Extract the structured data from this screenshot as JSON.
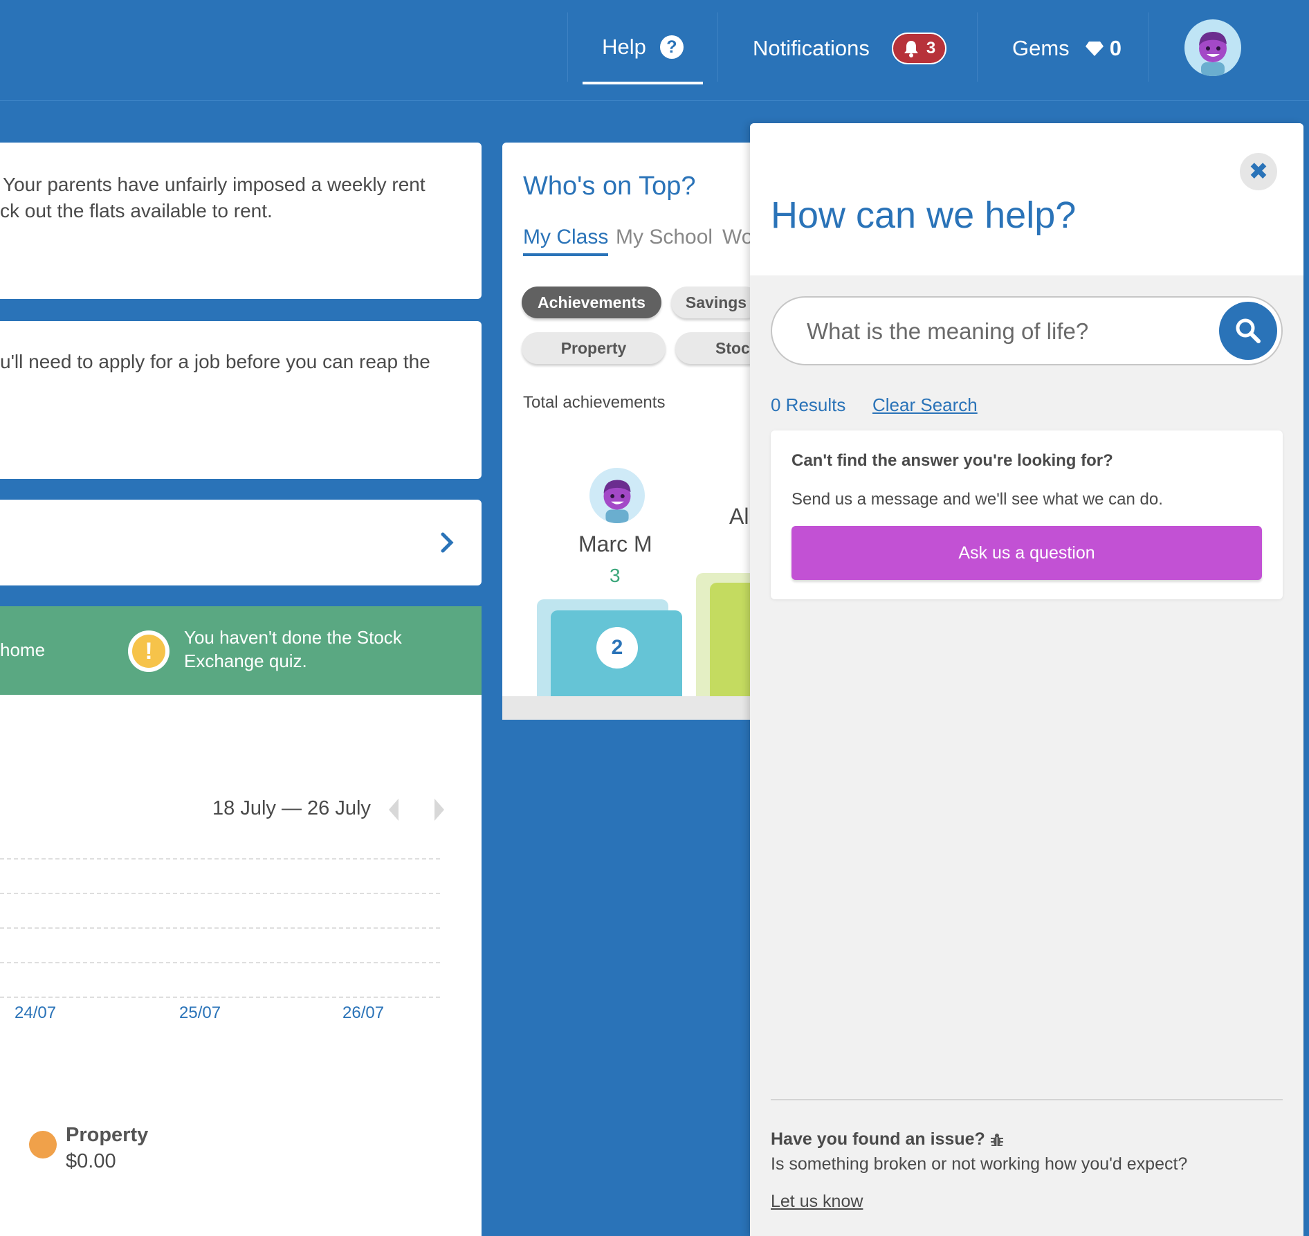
{
  "topbar": {
    "help_label": "Help",
    "help_icon": "?",
    "notifications_label": "Notifications",
    "notifications_count": "3",
    "gems_label": "Gems",
    "gems_count": "0"
  },
  "left_cards": {
    "card1_line1": "Your parents have unfairly imposed a weekly rent",
    "card1_line2": "ck out the flats available to rent.",
    "card2_line1": "u'll need to apply for a job before you can reap the"
  },
  "banner": {
    "left_text": "home",
    "warning_icon": "!",
    "warning_line1": "You haven't done the Stock",
    "warning_line2": "Exchange quiz."
  },
  "chart": {
    "date_range": "18 July — 26 July",
    "ticks": [
      "24/07",
      "25/07",
      "26/07"
    ],
    "legend": {
      "name": "Property",
      "value": "$0.00",
      "color": "#f0a14a"
    }
  },
  "who": {
    "title": "Who's on Top?",
    "tabs": [
      "My Class",
      "My School",
      "Wo"
    ],
    "pills": [
      "Achievements",
      "Savings",
      "Property",
      "Stocl"
    ],
    "total_label": "Total achievements",
    "first": {
      "name": "Marc M",
      "score": "3",
      "rank": "2"
    },
    "second_partial_name": "Al"
  },
  "help": {
    "title": "How can we help?",
    "close_icon": "✖",
    "search_placeholder": "What is the meaning of life?",
    "results": "0 Results",
    "clear_search": "Clear Search",
    "answer_title": "Can't find the answer you're looking for?",
    "answer_text": "Send us a message and we'll see what we can do.",
    "ask_button": "Ask us a question",
    "issue_title": "Have you found an issue?",
    "issue_text": "Is something broken or not working how you'd expect?",
    "issue_link": "Let us know"
  },
  "colors": {
    "brand_blue": "#2a73b8",
    "banner_green": "#5aa882",
    "ask_purple": "#c251d4",
    "badge_red": "#b7323a"
  }
}
